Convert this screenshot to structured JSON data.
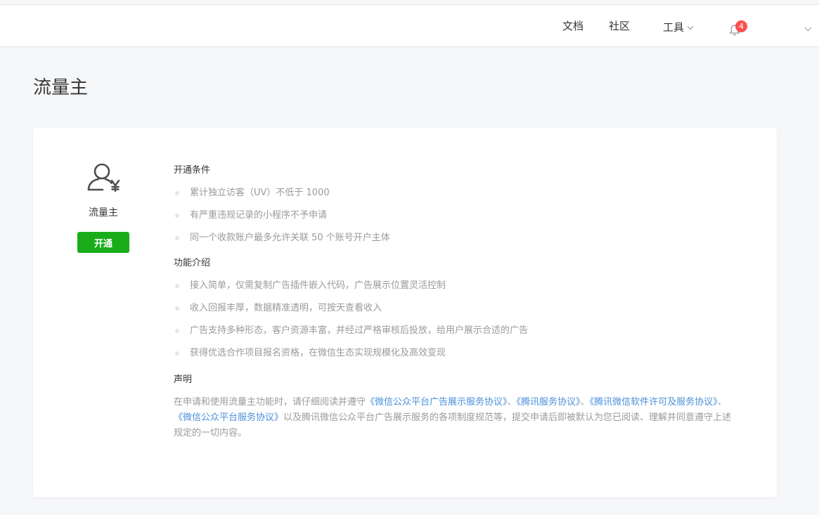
{
  "header": {
    "nav": {
      "docs": "文档",
      "community": "社区",
      "tools": "工具"
    },
    "notifications": {
      "count": "4",
      "icon": "bell-icon"
    },
    "account_menu_icon": "chevron-down-icon"
  },
  "page": {
    "title": "流量主"
  },
  "service": {
    "icon": "user-yen-icon",
    "name": "流量主",
    "open_button": "开通",
    "accent_color": "#1aad19"
  },
  "conditions": {
    "title": "开通条件",
    "items": [
      "累计独立访客（UV）不低于 1000",
      "有严重违规记录的小程序不予申请",
      "同一个收款账户最多允许关联 50 个账号开户主体"
    ]
  },
  "features": {
    "title": "功能介绍",
    "items": [
      "接入简单，仅需复制广告插件嵌入代码，广告展示位置灵活控制",
      "收入回报丰厚，数据精准透明，可按天查看收入",
      "广告支持多种形态，客户资源丰富，并经过严格审核后投放，给用户展示合适的广告",
      "获得优选合作项目报名资格，在微信生态实现规模化及高效变现"
    ]
  },
  "statement": {
    "title": "声明",
    "text_before": "在申请和使用流量主功能时，请仔细阅读并遵守",
    "link1": "《微信公众平台广告展示服务协议》",
    "sep1": "、",
    "link2": "《腾讯服务协议》",
    "sep2": "、",
    "link3": "《腾讯微信软件许可及服务协议》",
    "sep3": "、",
    "link4": "《微信公众平台服务协议》",
    "text_after": "以及腾讯微信公众平台广告展示服务的各项制度规范等，提交申请后即被默认为您已阅读、理解并同意遵守上述规定的一切内容。"
  }
}
